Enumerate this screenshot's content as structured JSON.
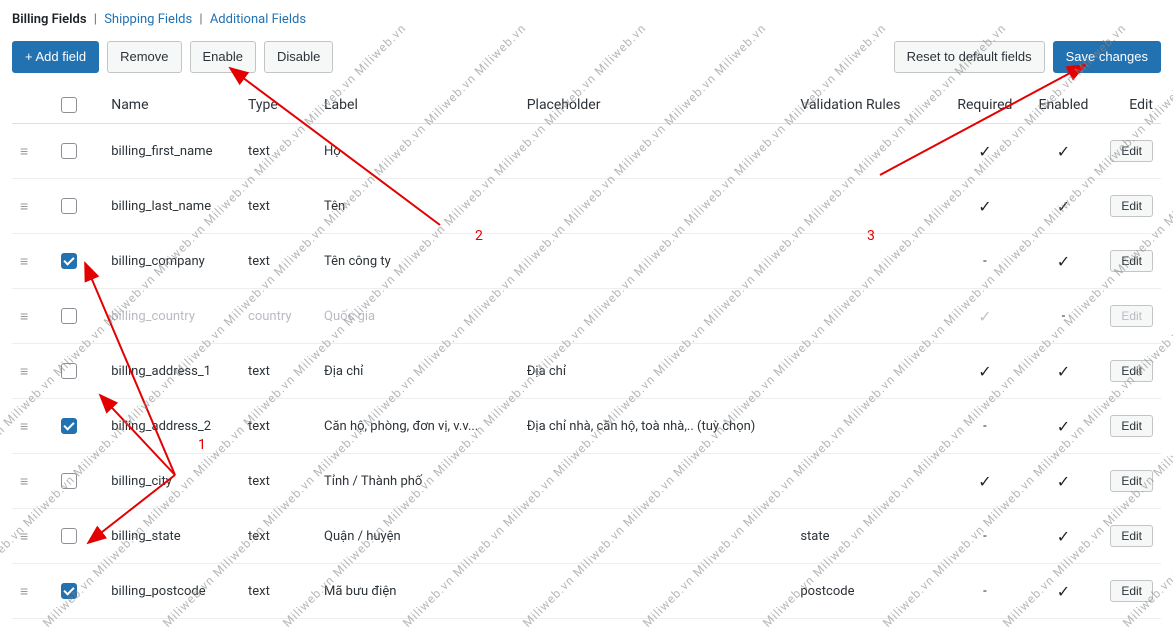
{
  "tabs": {
    "billing": "Billing Fields",
    "shipping": "Shipping Fields",
    "additional": "Additional Fields"
  },
  "toolbar": {
    "add": "+ Add field",
    "remove": "Remove",
    "enable": "Enable",
    "disable": "Disable",
    "reset": "Reset to default fields",
    "save": "Save changes"
  },
  "columns": {
    "name": "Name",
    "type": "Type",
    "label": "Label",
    "placeholder": "Placeholder",
    "validation": "Validation Rules",
    "required": "Required",
    "enabled": "Enabled",
    "edit": "Edit"
  },
  "rows": [
    {
      "checked": false,
      "name": "billing_first_name",
      "type": "text",
      "label": "Họ",
      "placeholder": "",
      "validation": "",
      "required": "check",
      "enabled": "check",
      "disabled_row": false
    },
    {
      "checked": false,
      "name": "billing_last_name",
      "type": "text",
      "label": "Tên",
      "placeholder": "",
      "validation": "",
      "required": "check",
      "enabled": "check",
      "disabled_row": false
    },
    {
      "checked": true,
      "name": "billing_company",
      "type": "text",
      "label": "Tên công ty",
      "placeholder": "",
      "validation": "",
      "required": "dash",
      "enabled": "check",
      "disabled_row": false
    },
    {
      "checked": false,
      "name": "billing_country",
      "type": "country",
      "label": "Quốc gia",
      "placeholder": "",
      "validation": "",
      "required": "check_disabled",
      "enabled": "dash",
      "disabled_row": true
    },
    {
      "checked": false,
      "name": "billing_address_1",
      "type": "text",
      "label": "Địa chỉ",
      "placeholder": "Địa chỉ",
      "validation": "",
      "required": "check",
      "enabled": "check",
      "disabled_row": false
    },
    {
      "checked": true,
      "name": "billing_address_2",
      "type": "text",
      "label": "Căn hộ, phòng, đơn vị, v.v...",
      "placeholder": "Địa chỉ nhà, căn hộ, toà nhà,.. (tuỳ chọn)",
      "validation": "",
      "required": "dash",
      "enabled": "check",
      "disabled_row": false
    },
    {
      "checked": false,
      "name": "billing_city",
      "type": "text",
      "label": "Tỉnh / Thành phố",
      "placeholder": "",
      "validation": "",
      "required": "check",
      "enabled": "check",
      "disabled_row": false
    },
    {
      "checked": false,
      "name": "billing_state",
      "type": "text",
      "label": "Quận / huyện",
      "placeholder": "",
      "validation": "state",
      "required": "dash",
      "enabled": "check",
      "disabled_row": false
    },
    {
      "checked": true,
      "name": "billing_postcode",
      "type": "text",
      "label": "Mã bưu điện",
      "placeholder": "",
      "validation": "postcode",
      "required": "dash",
      "enabled": "check",
      "disabled_row": false
    }
  ],
  "edit_label": "Edit",
  "annotations": {
    "n1": "1",
    "n2": "2",
    "n3": "3"
  },
  "watermark_text": "Miliweb.vn Miliweb.vn Miliweb.vn Miliweb.vn Miliweb.vn Miliweb.vn Miliweb.vn Miliweb.vn Miliweb.vn Miliweb.vn Miliweb.vn Miliweb.vn"
}
